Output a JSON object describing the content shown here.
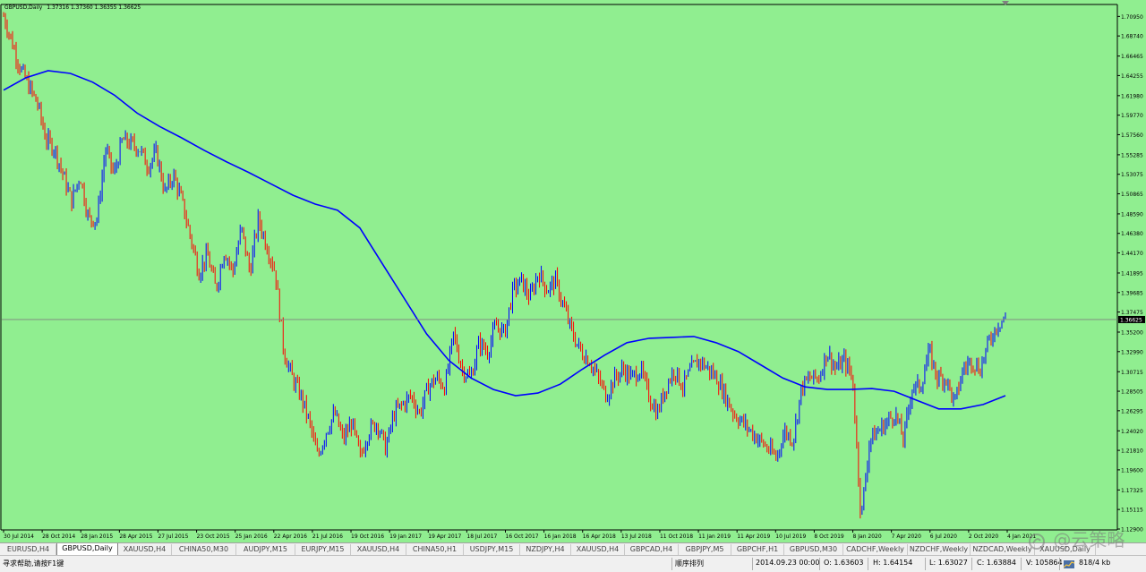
{
  "header": {
    "symbol_timeframe": "GBPUSD,Daily",
    "ohlc": "1.37316 1.37360 1.36355 1.36625"
  },
  "colors": {
    "background": "#90ee90",
    "moving_average": "#0000ff",
    "candle_up": "#0000ff",
    "candle_down": "#ff0000",
    "price_line": "#808080"
  },
  "chart_data": {
    "type": "line",
    "title": "GBPUSD,Daily",
    "xlabel": "",
    "ylabel": "",
    "ylim": [
      1.13,
      1.72
    ],
    "current_price": 1.36625,
    "y_ticks": [
      "1.70950",
      "1.68740",
      "1.66465",
      "1.64255",
      "1.61980",
      "1.59770",
      "1.57560",
      "1.55285",
      "1.53075",
      "1.50865",
      "1.48590",
      "1.46380",
      "1.44170",
      "1.41895",
      "1.39685",
      "1.37475",
      "1.35200",
      "1.32990",
      "1.30715",
      "1.28505",
      "1.26295",
      "1.24020",
      "1.21810",
      "1.19600",
      "1.17325",
      "1.15115",
      "1.12900"
    ],
    "x_ticks": [
      "30 Jul 2014",
      "28 Oct 2014",
      "28 Jan 2015",
      "28 Apr 2015",
      "27 Jul 2015",
      "23 Oct 2015",
      "25 Jan 2016",
      "22 Apr 2016",
      "21 Jul 2016",
      "19 Oct 2016",
      "19 Jan 2017",
      "19 Apr 2017",
      "18 Jul 2017",
      "16 Oct 2017",
      "16 Jan 2018",
      "16 Apr 2018",
      "13 Jul 2018",
      "11 Oct 2018",
      "11 Jan 2019",
      "11 Apr 2019",
      "10 Jul 2019",
      "8 Oct 2019",
      "8 Jan 2020",
      "7 Apr 2020",
      "6 Jul 2020",
      "2 Oct 2020",
      "4 Jan 2021"
    ],
    "series": [
      {
        "values": [
          1.71,
          1.68,
          1.65,
          1.63,
          1.61,
          1.57,
          1.56,
          1.53,
          1.5,
          1.53,
          1.48,
          1.48,
          1.56,
          1.53,
          1.57,
          1.565,
          1.56,
          1.54,
          1.555,
          1.51,
          1.53,
          1.5,
          1.46,
          1.42,
          1.44,
          1.4,
          1.445,
          1.42,
          1.47,
          1.42,
          1.48,
          1.45,
          1.42,
          1.33,
          1.3,
          1.28,
          1.25,
          1.21,
          1.24,
          1.26,
          1.23,
          1.25,
          1.21,
          1.24,
          1.25,
          1.22,
          1.26,
          1.27,
          1.28,
          1.26,
          1.29,
          1.3,
          1.29,
          1.35,
          1.31,
          1.3,
          1.34,
          1.33,
          1.36,
          1.35,
          1.4,
          1.41,
          1.39,
          1.42,
          1.4,
          1.41,
          1.38,
          1.35,
          1.33,
          1.32,
          1.3,
          1.28,
          1.3,
          1.31,
          1.3,
          1.31,
          1.28,
          1.26,
          1.29,
          1.31,
          1.29,
          1.31,
          1.32,
          1.31,
          1.3,
          1.28,
          1.26,
          1.25,
          1.24,
          1.23,
          1.22,
          1.21,
          1.24,
          1.23,
          1.29,
          1.3,
          1.3,
          1.33,
          1.31,
          1.32,
          1.3,
          1.14,
          1.23,
          1.24,
          1.25,
          1.26,
          1.23,
          1.29,
          1.29,
          1.33,
          1.3,
          1.3,
          1.27,
          1.31,
          1.32,
          1.31,
          1.34,
          1.36,
          1.37
        ]
      },
      {
        "name": "Moving Average",
        "values": [
          1.626,
          1.64,
          1.648,
          1.645,
          1.635,
          1.62,
          1.6,
          1.585,
          1.572,
          1.558,
          1.545,
          1.533,
          1.52,
          1.507,
          1.497,
          1.49,
          1.47,
          1.43,
          1.39,
          1.35,
          1.32,
          1.3,
          1.287,
          1.28,
          1.283,
          1.293,
          1.31,
          1.326,
          1.34,
          1.345,
          1.346,
          1.347,
          1.34,
          1.33,
          1.315,
          1.3,
          1.29,
          1.287,
          1.287,
          1.288,
          1.285,
          1.275,
          1.265,
          1.265,
          1.27,
          1.28
        ]
      }
    ]
  },
  "tabs": [
    {
      "label": "EURUSD,H4",
      "active": false
    },
    {
      "label": "GBPUSD,Daily",
      "active": true
    },
    {
      "label": "XAUUSD,H4",
      "active": false
    },
    {
      "label": "CHINA50,M30",
      "active": false
    },
    {
      "label": "AUDJPY,M15",
      "active": false
    },
    {
      "label": "EURJPY,M15",
      "active": false
    },
    {
      "label": "XAUUSD,H4",
      "active": false
    },
    {
      "label": "CHINA50,H1",
      "active": false
    },
    {
      "label": "USDJPY,M15",
      "active": false
    },
    {
      "label": "NZDJPY,H4",
      "active": false
    },
    {
      "label": "XAUUSD,H4",
      "active": false
    },
    {
      "label": "GBPCAD,H4",
      "active": false
    },
    {
      "label": "GBPJPY,M5",
      "active": false
    },
    {
      "label": "GBPCHF,H1",
      "active": false
    },
    {
      "label": "GBPUSD,M30",
      "active": false
    },
    {
      "label": "CADCHF,Weekly",
      "active": false
    },
    {
      "label": "NZDCHF,Weekly",
      "active": false
    },
    {
      "label": "NZDCAD,Weekly",
      "active": false
    },
    {
      "label": "XAUUSD,Daily",
      "active": false
    }
  ],
  "status": {
    "help": "寻求帮助,请按F1键",
    "profile": "顺序排列",
    "datetime": "2014.09.23 00:00",
    "open": "O: 1.63603",
    "high": "H: 1.64154",
    "low": "L: 1.63027",
    "close": "C: 1.63884",
    "volume": "V: 105864",
    "traffic": "818/4 kb"
  },
  "watermark": {
    "text": "@云策略"
  }
}
